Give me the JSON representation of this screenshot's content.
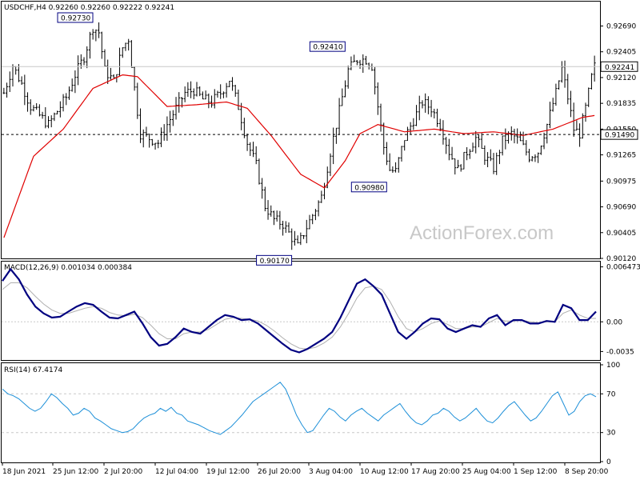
{
  "header": {
    "symbol_title": "USDCHF,H4  0.92260 0.92260 0.92222 0.92241"
  },
  "watermark": "ActionForex.com",
  "colors": {
    "bars": "#000000",
    "ma": "#e00000",
    "macd": "#000080",
    "signal": "#b0b0b0",
    "rsi": "#1c8fd8",
    "label_border": "#000080",
    "grid": "#c8c8c8"
  },
  "chart_data": [
    {
      "type": "ohlc",
      "title": "USDCHF,H4  0.92260 0.92260 0.92222 0.92241",
      "ylim": [
        0.9012,
        0.9296
      ],
      "y_ticks": [
        "0.92690",
        "0.92405",
        "0.92120",
        "0.91835",
        "0.91550",
        "0.91265",
        "0.90975",
        "0.90690",
        "0.90405",
        "0.90120"
      ],
      "current_price": "0.92241",
      "horizontal_line_label": "0.91490",
      "annotations": [
        "0.92730",
        "0.92410",
        "0.90980",
        "0.90170"
      ],
      "x_ticks": [
        "18 Jun 2021",
        "25 Jun 12:00",
        "2 Jul 20:00",
        "12 Jul 04:00",
        "19 Jul 12:00",
        "26 Jul 20:00",
        "3 Aug 04:00",
        "10 Aug 12:00",
        "17 Aug 20:00",
        "25 Aug 04:00",
        "1 Sep 12:00",
        "8 Sep 20:00"
      ],
      "close_profile": [
        [
          0,
          0.9195
        ],
        [
          3,
          0.9225
        ],
        [
          6,
          0.9205
        ],
        [
          9,
          0.918
        ],
        [
          12,
          0.917
        ],
        [
          15,
          0.916
        ],
        [
          18,
          0.9175
        ],
        [
          21,
          0.919
        ],
        [
          24,
          0.9215
        ],
        [
          27,
          0.9235
        ],
        [
          30,
          0.9268
        ],
        [
          32,
          0.9262
        ],
        [
          34,
          0.922
        ],
        [
          37,
          0.9208
        ],
        [
          40,
          0.9245
        ],
        [
          42,
          0.9255
        ],
        [
          44,
          0.92
        ],
        [
          46,
          0.915
        ],
        [
          49,
          0.9145
        ],
        [
          52,
          0.914
        ],
        [
          55,
          0.916
        ],
        [
          58,
          0.9178
        ],
        [
          61,
          0.9195
        ],
        [
          64,
          0.9198
        ],
        [
          67,
          0.9188
        ],
        [
          70,
          0.9185
        ],
        [
          73,
          0.9195
        ],
        [
          76,
          0.921
        ],
        [
          79,
          0.918
        ],
        [
          82,
          0.914
        ],
        [
          85,
          0.9115
        ],
        [
          88,
          0.907
        ],
        [
          91,
          0.9055
        ],
        [
          94,
          0.905
        ],
        [
          97,
          0.9035
        ],
        [
          99,
          0.9025
        ],
        [
          101,
          0.904
        ],
        [
          104,
          0.906
        ],
        [
          107,
          0.908
        ],
        [
          110,
          0.913
        ],
        [
          113,
          0.9175
        ],
        [
          116,
          0.922
        ],
        [
          119,
          0.9232
        ],
        [
          122,
          0.9232
        ],
        [
          124,
          0.9225
        ],
        [
          126,
          0.918
        ],
        [
          128,
          0.9135
        ],
        [
          130,
          0.911
        ],
        [
          132,
          0.9108
        ],
        [
          135,
          0.9145
        ],
        [
          138,
          0.9165
        ],
        [
          141,
          0.9185
        ],
        [
          144,
          0.9178
        ],
        [
          147,
          0.916
        ],
        [
          150,
          0.913
        ],
        [
          153,
          0.911
        ],
        [
          156,
          0.913
        ],
        [
          159,
          0.9145
        ],
        [
          162,
          0.9125
        ],
        [
          165,
          0.9112
        ],
        [
          168,
          0.9142
        ],
        [
          171,
          0.915
        ],
        [
          174,
          0.914
        ],
        [
          177,
          0.9125
        ],
        [
          180,
          0.913
        ],
        [
          183,
          0.916
        ],
        [
          186,
          0.9195
        ],
        [
          188,
          0.9222
        ],
        [
          190,
          0.919
        ],
        [
          192,
          0.9155
        ],
        [
          194,
          0.915
        ],
        [
          196,
          0.9178
        ],
        [
          198,
          0.9212
        ],
        [
          199,
          0.9224
        ]
      ],
      "series": [
        {
          "name": "",
          "ma_profile": [
            [
              0,
              0.9035
            ],
            [
              10,
              0.9125
            ],
            [
              20,
              0.9155
            ],
            [
              30,
              0.92
            ],
            [
              40,
              0.9215
            ],
            [
              45,
              0.9213
            ],
            [
              55,
              0.918
            ],
            [
              65,
              0.9182
            ],
            [
              75,
              0.9185
            ],
            [
              82,
              0.9178
            ],
            [
              90,
              0.9148
            ],
            [
              100,
              0.9105
            ],
            [
              108,
              0.909
            ],
            [
              115,
              0.912
            ],
            [
              120,
              0.915
            ],
            [
              126,
              0.916
            ],
            [
              135,
              0.9152
            ],
            [
              145,
              0.9155
            ],
            [
              155,
              0.915
            ],
            [
              165,
              0.9152
            ],
            [
              175,
              0.9148
            ],
            [
              185,
              0.9155
            ],
            [
              195,
              0.9168
            ],
            [
              199,
              0.917
            ]
          ]
        }
      ]
    },
    {
      "type": "line",
      "title": "MACD(12,26,9) 0.001034 0.000384",
      "ylim": [
        -0.0045,
        0.007
      ],
      "y_ticks": [
        "0.006473",
        "0.00",
        "-0.0035"
      ],
      "series": [
        {
          "name": "",
          "values": [
            0.0048,
            0.0062,
            0.005,
            0.0032,
            0.0018,
            0.001,
            0.0005,
            0.0006,
            0.0012,
            0.0018,
            0.0022,
            0.002,
            0.0012,
            0.0005,
            0.0004,
            0.0008,
            0.0012,
            -0.0002,
            -0.0018,
            -0.0028,
            -0.0026,
            -0.0018,
            -0.0008,
            -0.0012,
            -0.0014,
            -0.0006,
            0.0002,
            0.0008,
            0.0006,
            0.0002,
            0.0003,
            -0.0002,
            -0.001,
            -0.0018,
            -0.0026,
            -0.0033,
            -0.0036,
            -0.0032,
            -0.0026,
            -0.002,
            -0.0012,
            0.0005,
            0.0025,
            0.0045,
            0.005,
            0.0042,
            0.0032,
            0.001,
            -0.0012,
            -0.002,
            -0.0012,
            -0.0002,
            0.0004,
            0.0003,
            -0.0008,
            -0.0012,
            -0.0008,
            -0.0004,
            -0.0006,
            0.0004,
            0.0008,
            -0.0004,
            0.0002,
            0.0002,
            -0.0002,
            -0.0002,
            0.0001,
            0.0,
            0.002,
            0.0016,
            0.0002,
            0.0002,
            0.0012
          ]
        },
        {
          "name": "",
          "values": [
            0.0038,
            0.0046,
            0.0046,
            0.004,
            0.003,
            0.0021,
            0.0014,
            0.001,
            0.001,
            0.0013,
            0.0016,
            0.0018,
            0.0016,
            0.0011,
            0.0008,
            0.0007,
            0.0009,
            0.0005,
            -0.0004,
            -0.0014,
            -0.002,
            -0.002,
            -0.0014,
            -0.0012,
            -0.0012,
            -0.0009,
            -0.0003,
            0.0003,
            0.0005,
            0.0004,
            0.0003,
            0.0001,
            -0.0004,
            -0.0011,
            -0.0019,
            -0.0026,
            -0.0031,
            -0.0032,
            -0.003,
            -0.0025,
            -0.0018,
            -0.0006,
            0.001,
            0.0028,
            0.004,
            0.0042,
            0.0038,
            0.0024,
            0.0006,
            -0.0008,
            -0.0012,
            -0.0008,
            -0.0002,
            0.0001,
            -0.0003,
            -0.0008,
            -0.0008,
            -0.0006,
            -0.0006,
            -0.0001,
            0.0004,
            0.0001,
            0.0001,
            0.0002,
            0.0,
            -0.0001,
            0.0,
            0.0,
            0.001,
            0.0014,
            0.0008,
            0.0004,
            0.0004
          ]
        }
      ]
    },
    {
      "type": "line",
      "title": "RSI(14) 67.4174",
      "ylim": [
        0,
        100
      ],
      "y_ticks": [
        "100",
        "70",
        "30",
        "0"
      ],
      "reference_levels": [
        70,
        30
      ],
      "series": [
        {
          "name": "",
          "values": [
            75,
            70,
            68,
            65,
            60,
            55,
            52,
            55,
            62,
            70,
            66,
            60,
            55,
            48,
            50,
            55,
            52,
            45,
            42,
            38,
            34,
            32,
            30,
            31,
            34,
            40,
            45,
            48,
            50,
            55,
            52,
            56,
            50,
            48,
            42,
            40,
            38,
            35,
            32,
            30,
            28,
            32,
            36,
            42,
            48,
            55,
            62,
            66,
            70,
            74,
            78,
            82,
            75,
            62,
            48,
            38,
            30,
            32,
            40,
            48,
            55,
            52,
            46,
            42,
            48,
            52,
            55,
            50,
            46,
            42,
            48,
            52,
            56,
            60,
            52,
            45,
            40,
            38,
            42,
            48,
            50,
            55,
            52,
            46,
            42,
            45,
            50,
            55,
            48,
            42,
            40,
            45,
            52,
            58,
            62,
            55,
            48,
            42,
            45,
            52,
            60,
            68,
            72,
            60,
            48,
            52,
            62,
            68,
            70,
            67
          ]
        }
      ]
    }
  ]
}
